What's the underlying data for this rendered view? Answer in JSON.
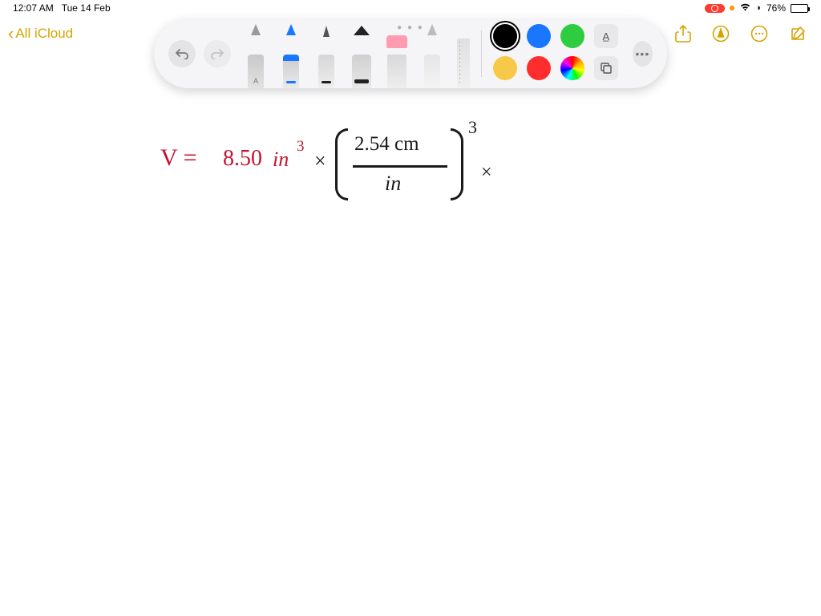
{
  "status": {
    "time": "12:07 AM",
    "date": "Tue 14 Feb",
    "battery_pct": "76%"
  },
  "nav": {
    "back_label": "All iCloud"
  },
  "toolbar": {
    "tools": [
      "pen",
      "marker",
      "pencil",
      "highlighter",
      "eraser",
      "lasso",
      "ruler"
    ],
    "colors": {
      "selected": "#000000",
      "row1": [
        "#000000",
        "#1976ff",
        "#2ecc40",
        "shape_a"
      ],
      "row2": [
        "#f7c948",
        "#ff2d2d",
        "rainbow",
        "shape_copy"
      ]
    }
  },
  "handwriting": {
    "v_eq": "V =",
    "val": "8.50",
    "unit1": "in",
    "exp1": "3",
    "times1": "×",
    "numer": "2.54 cm",
    "denom": "in",
    "exp2": "3",
    "times2": "×"
  }
}
